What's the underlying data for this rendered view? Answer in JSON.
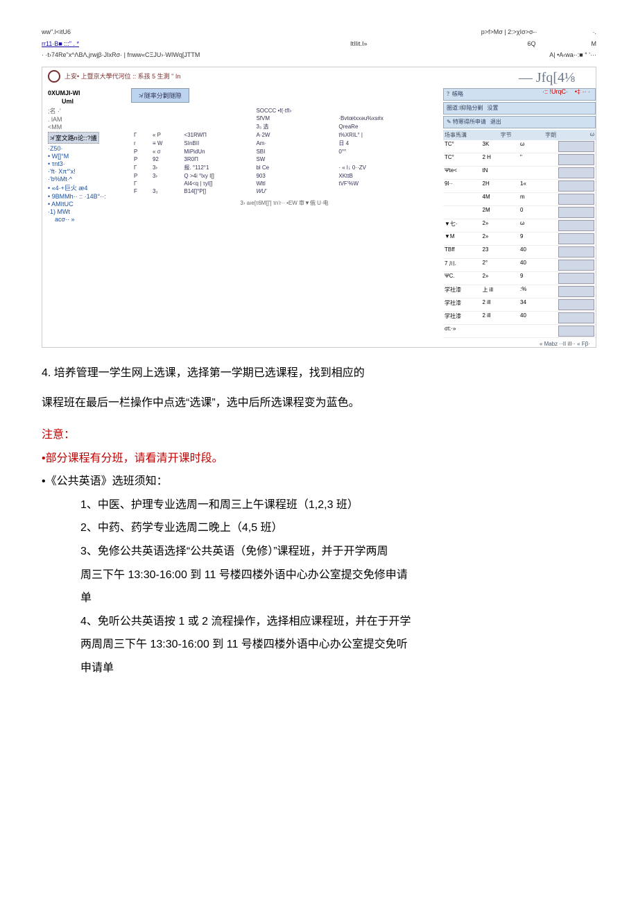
{
  "garble": {
    "top_left": "ww\".l<itU6",
    "top_right_a": "p>f>Mσ | 2:>χIσ>σ-·",
    "top_right_b": "·.",
    "line2_left": "rr11·B■ :::\" . *",
    "line2_mid": "ItIIit.I»",
    "line2_right_a": "6Q",
    "line2_right_b": "M",
    "line3_left": "·  ·t›74Re\"x^ΛBΛ,jrwjβ·JIxRσ·  | fnww«CΞJU›·WIWq[JTTM",
    "line3_right": "A| •A‹wa-·:■ ° '···"
  },
  "ss": {
    "header_small": "上安• 上暨京大學代河位 :: 系孩 5 生測 \" In",
    "right_title": "— Jfq[4⅛",
    "right_sub": "·:: !UrqC·",
    "right_sub2": "•‡ ·· ·",
    "sidebar": {
      "hd1": "0XUMJI-WI",
      "uml": "Uml",
      "l1": ";名 ·'",
      "l2": ". lAM",
      "l3": "<MM",
      "sel": "≯ 室文路n论::?議",
      "link1": "·Z50·",
      "link2": "• W[]°M",
      "link3": "• τnt3·",
      "link4": "·'ft· Xπ°'x!",
      "link5": "·'b%Mt·^",
      "link6": "• «4·+巨火 æ4",
      "link7": "• 9BMMh·· :: ·14B°··:",
      "link8": "• AMItUC",
      "link9": "·1) MWt",
      "link10": "acσ·· »"
    },
    "btn": "≯ 隧率分剿隧隙",
    "rtbl_tools": {
      "a": "？帳略",
      "b": "圏道:I抑陥分剿",
      "c": "没置",
      "d": "✎ 特寒得所申请",
      "e": "退出"
    },
    "rtbl_hdr": {
      "a": "场事馬溝",
      "b": "字节",
      "c": "字朗",
      "d": "ω"
    },
    "rtbl_rows": [
      {
        "a": "TC°",
        "b": "3K",
        "c": "ω"
      },
      {
        "a": "TC°",
        "b": "2 H",
        "c": "\""
      },
      {
        "a": "Ψte<",
        "b": "tN",
        "c": ""
      },
      {
        "a": "9I··",
        "b": "2H",
        "c": "1«"
      },
      {
        "a": "",
        "b": "4M",
        "c": "m"
      },
      {
        "a": "",
        "b": "2M",
        "c": "0"
      },
      {
        "a": "▼七·",
        "b": "2»",
        "c": "ω"
      },
      {
        "a": "▼M",
        "b": "2»",
        "c": "9"
      },
      {
        "a": "TBff",
        "b": "23",
        "c": "40"
      },
      {
        "a": "7 川.",
        "b": "2°",
        "c": "40"
      },
      {
        "a": "ΨC.",
        "b": "2»",
        "c": "9"
      },
      {
        "a": "学社漆",
        "b": "上 ill",
        "c": ":%"
      },
      {
        "a": "学社漆",
        "b": "2 ill",
        "c": "34"
      },
      {
        "a": "学社漆",
        "b": "2 ill",
        "c": "40"
      },
      {
        "a": "σt:·»",
        "b": "",
        "c": ""
      }
    ],
    "mid_col1": [
      "Γ",
      "r",
      "P",
      "P",
      "Γ",
      "P",
      "Γ",
      "F"
    ],
    "mid_col2": [
      "« Ρ",
      "≡ W",
      "« σ",
      "92",
      "3›",
      "3›",
      "",
      "3₃"
    ],
    "mid_col3": [
      "<31RWΠ",
      "SInBII",
      "MiPidUn",
      "3R0Π",
      "报.  °112°1",
      "Q >4i °lxy I[]",
      "Al4<q | τyI[]",
      "B14[]°P[]"
    ],
    "mid_col4": [
      "SOCCC •f(·tfI›",
      "SfVM",
      "3₃ 选",
      "A·2W",
      "Am·",
      "SBI",
      "SW",
      "bl Ce",
      "903",
      "Wltl",
      "WU'"
    ],
    "mid_col5": [
      "",
      "·Bvtœtxxəu%xs#x",
      "QreaRe",
      "t%XRIL° |",
      "日 4",
      "0°°",
      "",
      "· « l↓ 0··ZV",
      "XKttB",
      "tVF'%W",
      ""
    ],
    "foot": "3› aıe[τ6M[]'] τn'r·· •EW 审▼俄 U·电",
    "rfoot": "« Mabz ··II iII·· « Fβ·"
  },
  "text": {
    "step": "4. 培养管理一学生网上选课，选择第一学期已选课程，找到相应的",
    "step2": "课程班在最后一栏操作中点选“选课”，选中后所选课程变为蓝色。",
    "note_hdr": "注意：",
    "bullet1": "•部分课程有分班，请看清开课时段。",
    "bullet2": "•《公共英语》选班须知：",
    "sub1": "1、中医、护理专业选周一和周三上午课程班（1,2,3 班）",
    "sub2": "2、中药、药学专业选周二晚上（4,5 班）",
    "sub3a": "3、免修公共英语选择“公共英语（免修）”课程班，并于开学两周",
    "sub3b": "周三下午 13:30-16:00 到 11 号楼四楼外语中心办公室提交免修申请",
    "sub3c": "单",
    "sub4a": "4、免听公共英语按 1 或 2 流程操作，选择相应课程班，并在于开学",
    "sub4b": "两周周三下午 13:30-16:00 到 11 号楼四楼外语中心办公室提交免听",
    "sub4c": "申请单"
  }
}
